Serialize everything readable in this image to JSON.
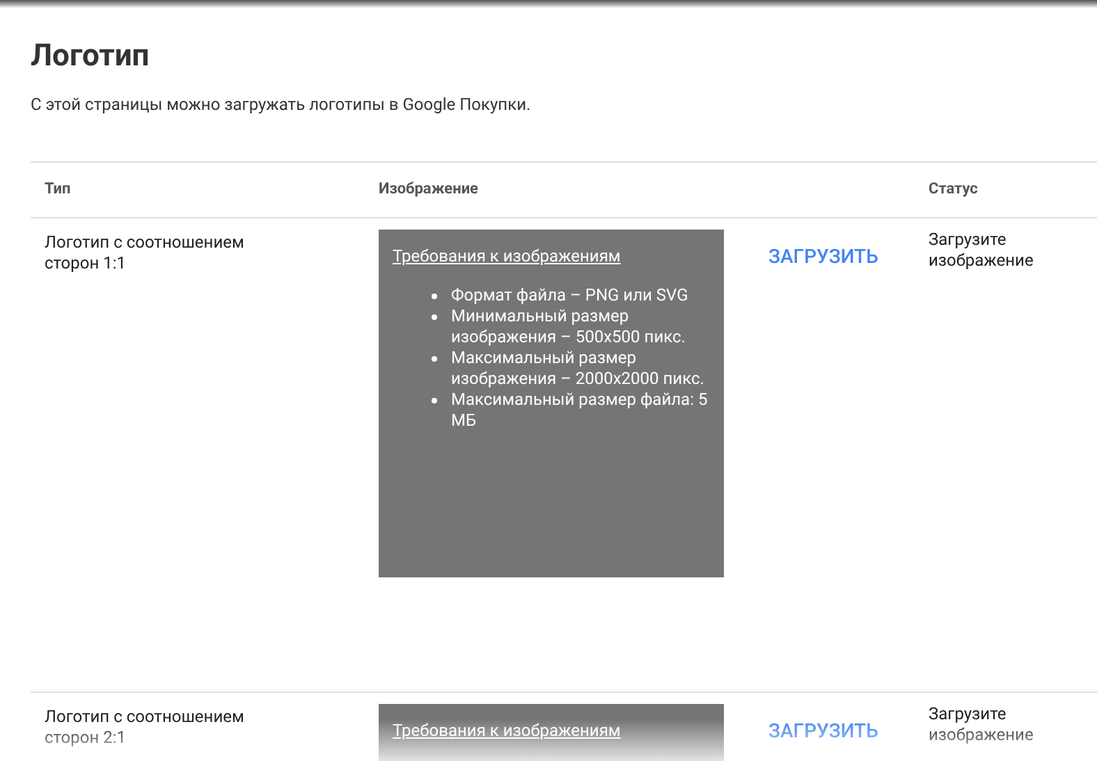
{
  "page": {
    "title": "Логотип",
    "description": "С этой страницы можно загружать логотипы в Google Покупки."
  },
  "table": {
    "columns": [
      "Тип",
      "Изображение",
      "Статус"
    ],
    "rows": [
      {
        "type": "Логотип с соотношением сторон 1:1",
        "requirements_link": "Требования к изображениям",
        "requirements": [
          "Формат файла – PNG или SVG",
          "Минимальный размер изображения – 500x500 пикс.",
          "Максимальный размер изображения – 2000x2000 пикс.",
          "Максимальный размер файла: 5 МБ"
        ],
        "upload": "ЗАГРУЗИТЬ",
        "status": "Загрузите изображение"
      },
      {
        "type": "Логотип с соотношением сторон 2:1",
        "requirements_link": "Требования к изображениям",
        "requirements": [],
        "upload": "ЗАГРУЗИТЬ",
        "status": "Загрузите изображение"
      }
    ]
  }
}
